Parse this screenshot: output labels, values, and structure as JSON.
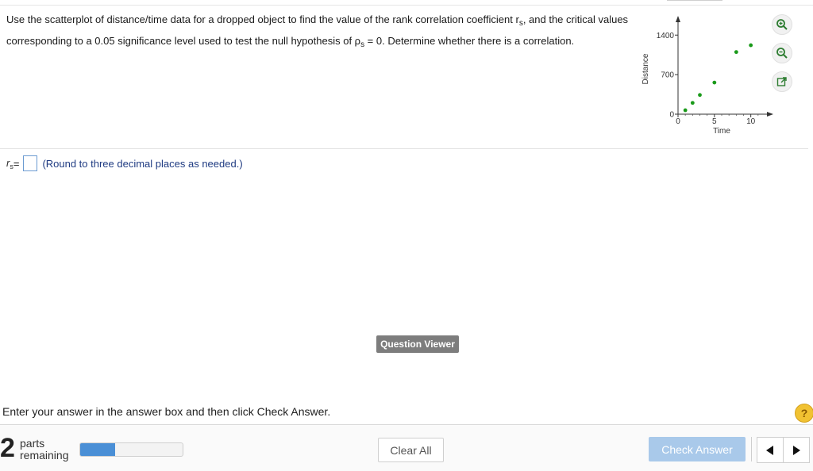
{
  "question": {
    "part1": "Use the scatterplot of distance/time data for a dropped object to find the value of the rank correlation coefficient r",
    "sub1": "s",
    "part2": ", and the critical values corresponding to a 0.05 significance level used to test the null hypothesis of ρ",
    "sub2": "s",
    "part3": " = 0. Determine whether there is a correlation."
  },
  "chart_data": {
    "type": "scatter",
    "xlabel": "Time",
    "ylabel": "Distance",
    "xlim": [
      0,
      12
    ],
    "ylim": [
      0,
      1600
    ],
    "x_ticks": [
      0,
      5,
      10
    ],
    "x_tick_labels": [
      "0",
      "5",
      "10"
    ],
    "y_ticks": [
      0,
      700,
      1400
    ],
    "y_tick_labels": [
      "0",
      "700",
      "1400"
    ],
    "points": [
      {
        "x": 1,
        "y": 70
      },
      {
        "x": 2,
        "y": 200
      },
      {
        "x": 3,
        "y": 340
      },
      {
        "x": 5,
        "y": 560
      },
      {
        "x": 8,
        "y": 1100
      },
      {
        "x": 10,
        "y": 1220
      }
    ],
    "point_color": "#1a9a1a"
  },
  "answer": {
    "rs_symbol": "r",
    "rs_sub": "s",
    "equals": " =",
    "note": "(Round to three decimal places as needed.)"
  },
  "question_viewer_label": "Question Viewer",
  "instructions": "Enter your answer in the answer box and then click Check Answer.",
  "footer": {
    "parts_count": "2",
    "parts_label_1": "parts",
    "parts_label_2": "remaining",
    "progress_fraction": 0.34,
    "clear_label": "Clear All",
    "check_label": "Check Answer",
    "help_label": "?"
  },
  "colors": {
    "accent": "#4a8fd6",
    "check_button": "#a9c9ea",
    "help_button": "#f1c232"
  }
}
